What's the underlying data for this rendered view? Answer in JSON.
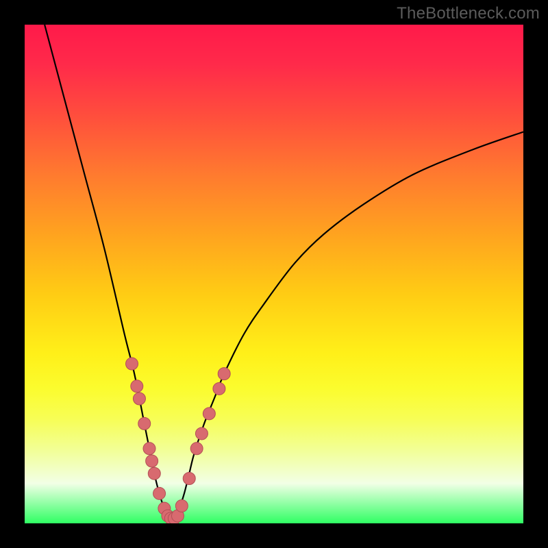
{
  "watermark": "TheBottleneck.com",
  "colors": {
    "background": "#000000",
    "curve": "#000000",
    "dot_fill": "#d86a6f",
    "dot_stroke": "#b24f55",
    "gradient_top": "#ff1a4a",
    "gradient_bottom": "#2fff63"
  },
  "chart_data": {
    "type": "line",
    "title": "",
    "xlabel": "",
    "ylabel": "",
    "xlim": [
      0,
      100
    ],
    "ylim": [
      0,
      100
    ],
    "grid": false,
    "legend": false,
    "note": "V-shaped bottleneck curve; y represents bottleneck percentage (0 = no bottleneck, green band at bottom). Minimum near x≈29. Values estimated from pixel positions rounded to 0.5.",
    "series": [
      {
        "name": "bottleneck-curve",
        "x": [
          4,
          8,
          12,
          16,
          20,
          22,
          24,
          25,
          26,
          27,
          28,
          29,
          30,
          31,
          32,
          33,
          34,
          36,
          38,
          40,
          44,
          48,
          54,
          60,
          68,
          78,
          90,
          100
        ],
        "y": [
          100,
          85,
          70,
          55,
          38,
          30,
          20,
          15,
          10,
          6,
          3,
          1,
          1,
          3,
          6,
          10,
          14,
          20,
          25,
          30,
          38,
          44,
          52,
          58,
          64,
          70,
          75,
          78.5
        ]
      }
    ],
    "highlight_dots": {
      "note": "Salmon dots marking sampled points on the curve in the lower region (y < ~30).",
      "points": [
        {
          "x": 21.5,
          "y": 32
        },
        {
          "x": 22.5,
          "y": 27.5
        },
        {
          "x": 23.0,
          "y": 25
        },
        {
          "x": 24.0,
          "y": 20
        },
        {
          "x": 25.0,
          "y": 15
        },
        {
          "x": 25.5,
          "y": 12.5
        },
        {
          "x": 26.0,
          "y": 10
        },
        {
          "x": 27.0,
          "y": 6
        },
        {
          "x": 28.0,
          "y": 3
        },
        {
          "x": 28.7,
          "y": 1.5
        },
        {
          "x": 29.3,
          "y": 1
        },
        {
          "x": 30.0,
          "y": 1
        },
        {
          "x": 30.7,
          "y": 1.5
        },
        {
          "x": 31.5,
          "y": 3.5
        },
        {
          "x": 33.0,
          "y": 9
        },
        {
          "x": 34.5,
          "y": 15
        },
        {
          "x": 35.5,
          "y": 18
        },
        {
          "x": 37.0,
          "y": 22
        },
        {
          "x": 39.0,
          "y": 27
        },
        {
          "x": 40.0,
          "y": 30
        }
      ]
    }
  }
}
